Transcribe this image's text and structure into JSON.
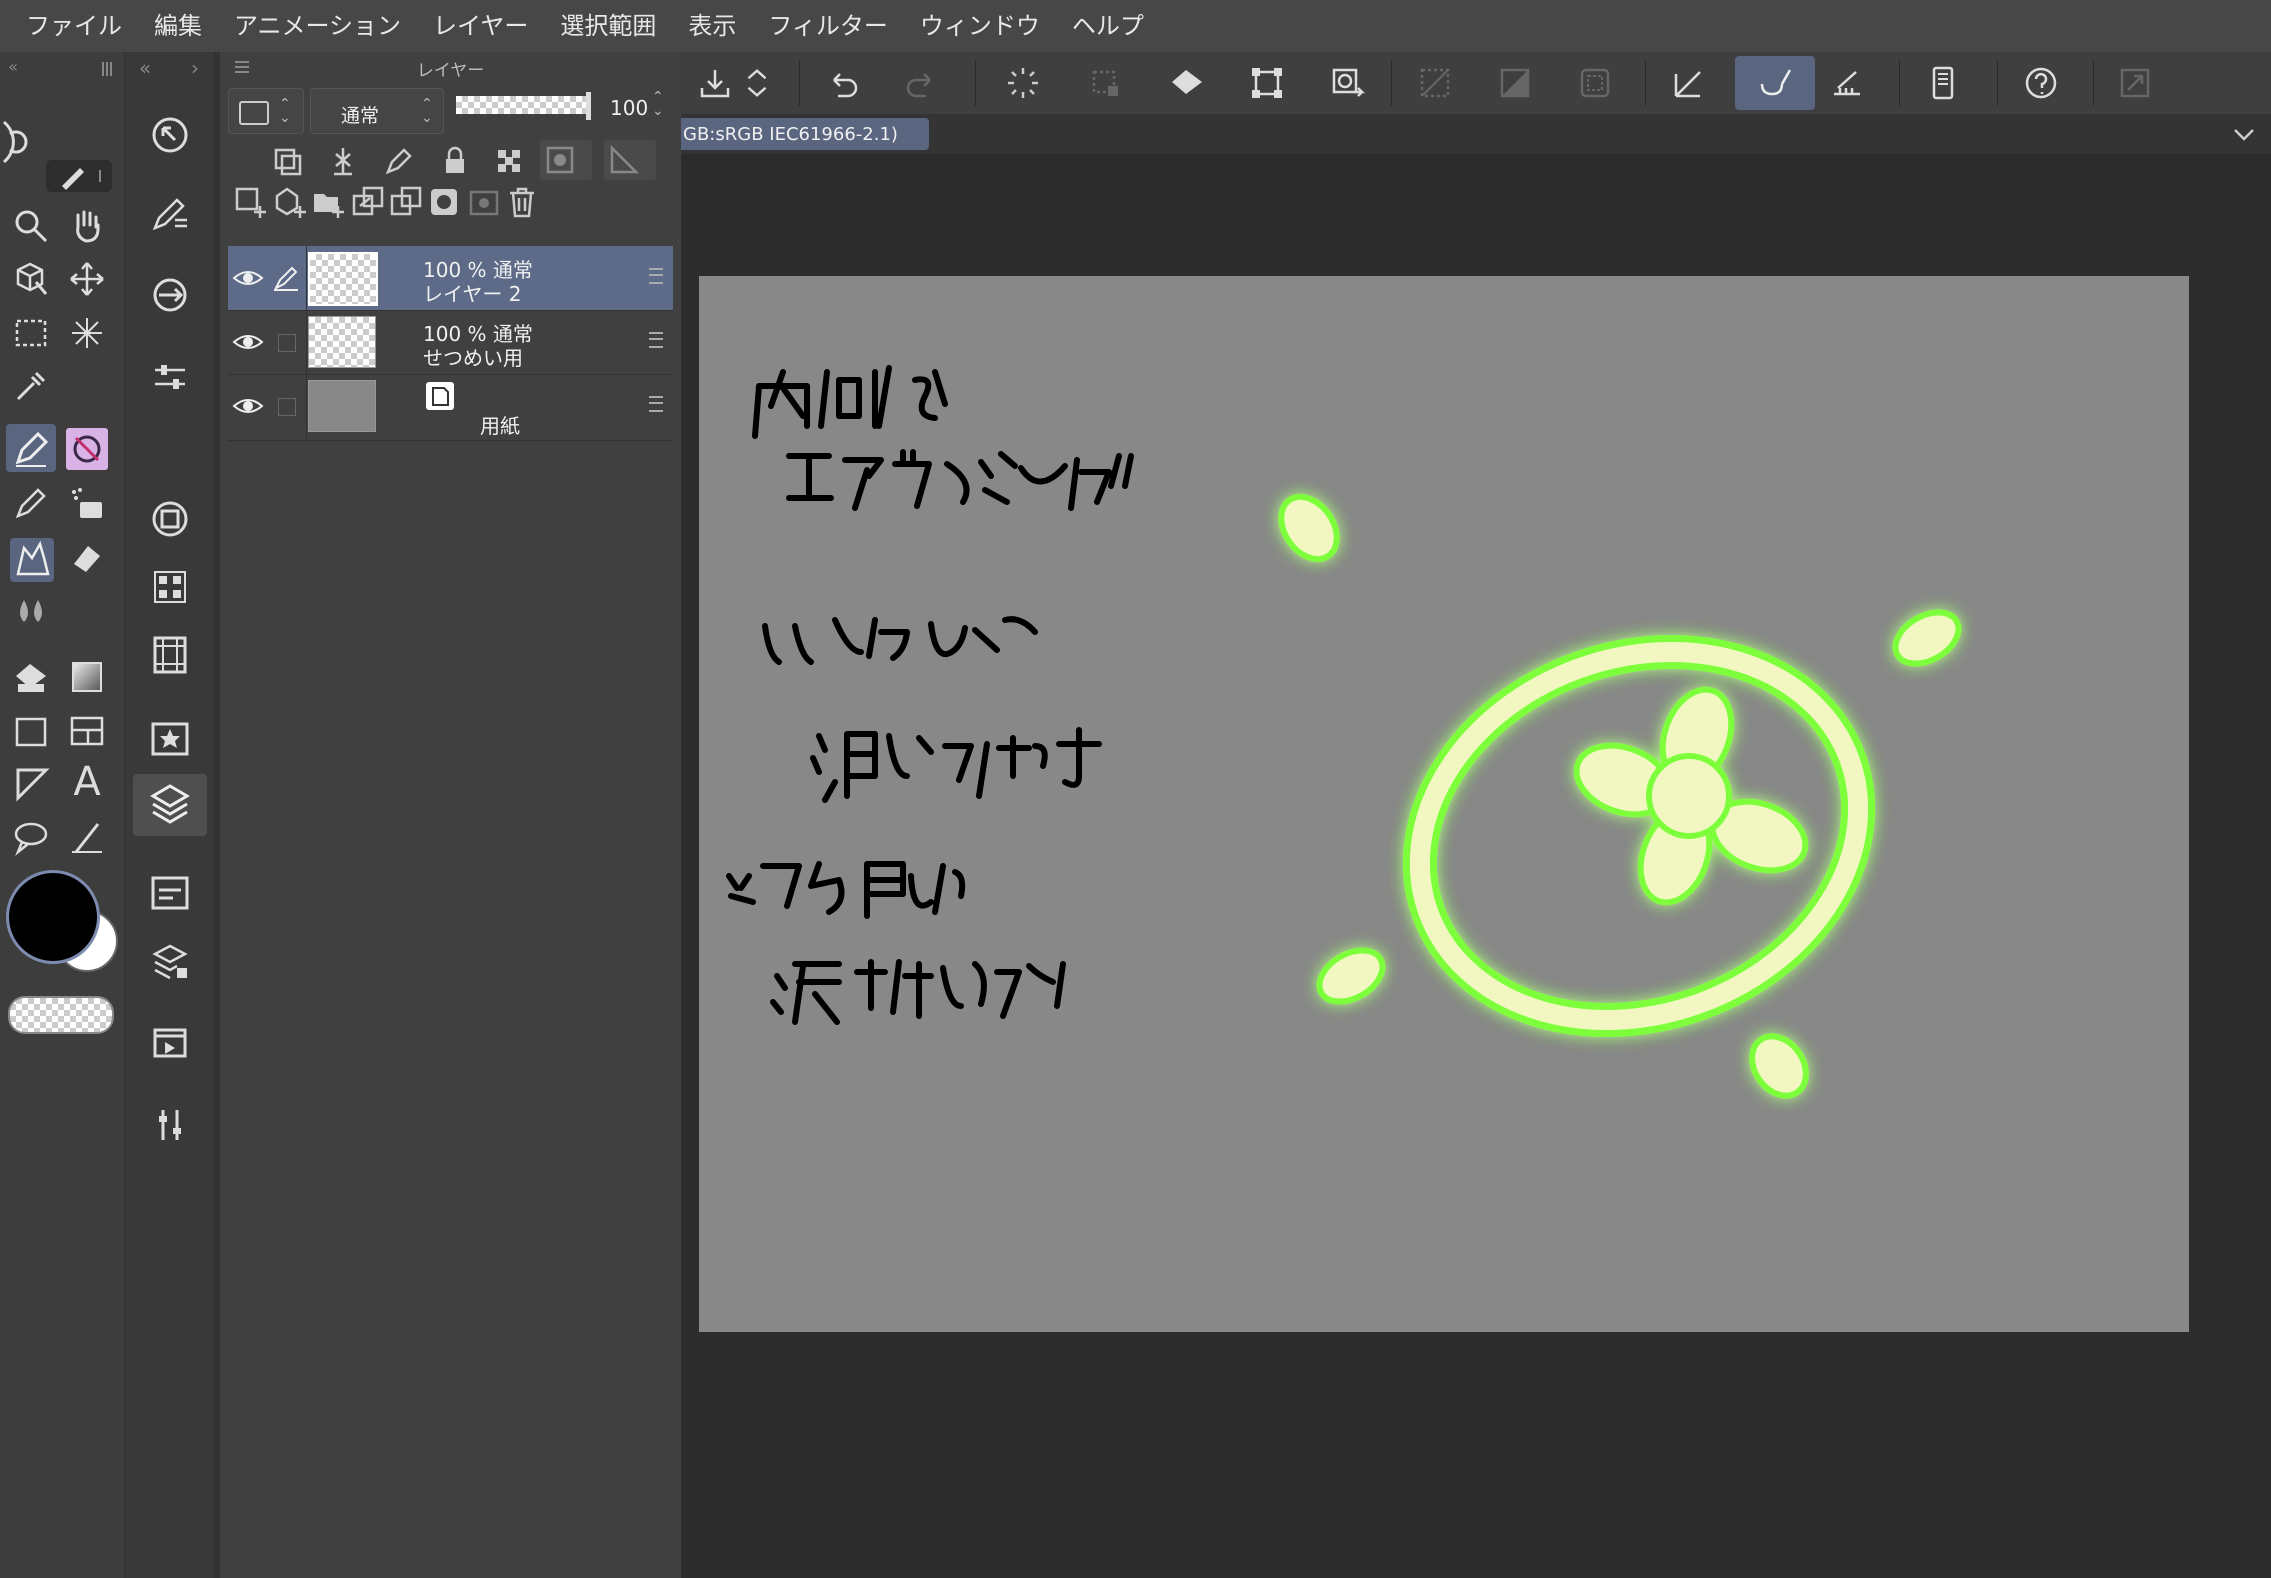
{
  "menubar": {
    "items": [
      "ファイル",
      "編集",
      "アニメーション",
      "レイヤー",
      "選択範囲",
      "表示",
      "フィルター",
      "ウィンドウ",
      "ヘルプ"
    ]
  },
  "layer_panel": {
    "title": "レイヤー",
    "blend_mode": "通常",
    "opacity": "100",
    "layers": [
      {
        "opacity_mode": "100 %  通常",
        "name": "レイヤー 2",
        "selected": true
      },
      {
        "opacity_mode": "100 %  通常",
        "name": "せつめい用",
        "selected": false
      },
      {
        "opacity_mode": "",
        "name": "用紙",
        "selected": false
      }
    ]
  },
  "document_tab": {
    "label": "GB:sRGB IEC61966-2.1)"
  },
  "colors": {
    "main_color": "#000000",
    "sub_color": "#ffffff",
    "paper": "#888888",
    "glow": "#7dff3a"
  },
  "toolbar": {
    "active_tool": "brush-icon"
  }
}
